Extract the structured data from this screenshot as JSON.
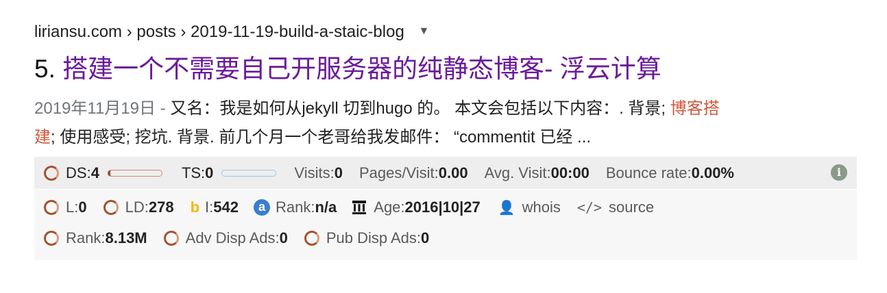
{
  "cite": {
    "url": "liriansu.com › posts › 2019-11-19-build-a-staic-blog",
    "dropdown": "▼"
  },
  "result": {
    "number": "5.",
    "title": "搭建一个不需要自己开服务器的纯静态博客- 浮云计算"
  },
  "snippet": {
    "date": "2019年11月19日 - ",
    "text1": "又名：我是如何从jekyll 切到hugo 的。 本文会包括以下内容：. 背景; ",
    "highlight_a": "博客搭",
    "highlight_b": "建",
    "text2": "; 使用感受; 挖坑. 背景. 前几个月一个老哥给我发邮件：  “commentit 已经 ..."
  },
  "seo_bar": {
    "ds_label": "DS: ",
    "ds_value": "4",
    "ts_label": "TS: ",
    "ts_value": "0",
    "visits_label": "Visits: ",
    "visits_value": "0",
    "pages_label": "Pages/Visit: ",
    "pages_value": "0.00",
    "avg_label": "Avg. Visit: ",
    "avg_value": "00:00",
    "bounce_label": "Bounce rate: ",
    "bounce_value": "0.00%",
    "info_glyph": "i"
  },
  "seo_panel": {
    "l_label": "L: ",
    "l_value": "0",
    "ld_label": "LD: ",
    "ld_value": "278",
    "i_label": "I: ",
    "i_value": "542",
    "rank_label": "Rank: ",
    "rank_value": "n/a",
    "age_label": "Age: ",
    "age_value": "2016|10|27",
    "whois_label": "whois",
    "source_label": "source",
    "rank2_label": "Rank: ",
    "rank2_value": "8.13M",
    "adv_label": "Adv Disp Ads: ",
    "adv_value": "0",
    "pub_label": "Pub Disp Ads: ",
    "pub_value": "0"
  },
  "icons": {
    "bing": "b",
    "alexa": "a",
    "user": "👤",
    "code": "</>"
  }
}
